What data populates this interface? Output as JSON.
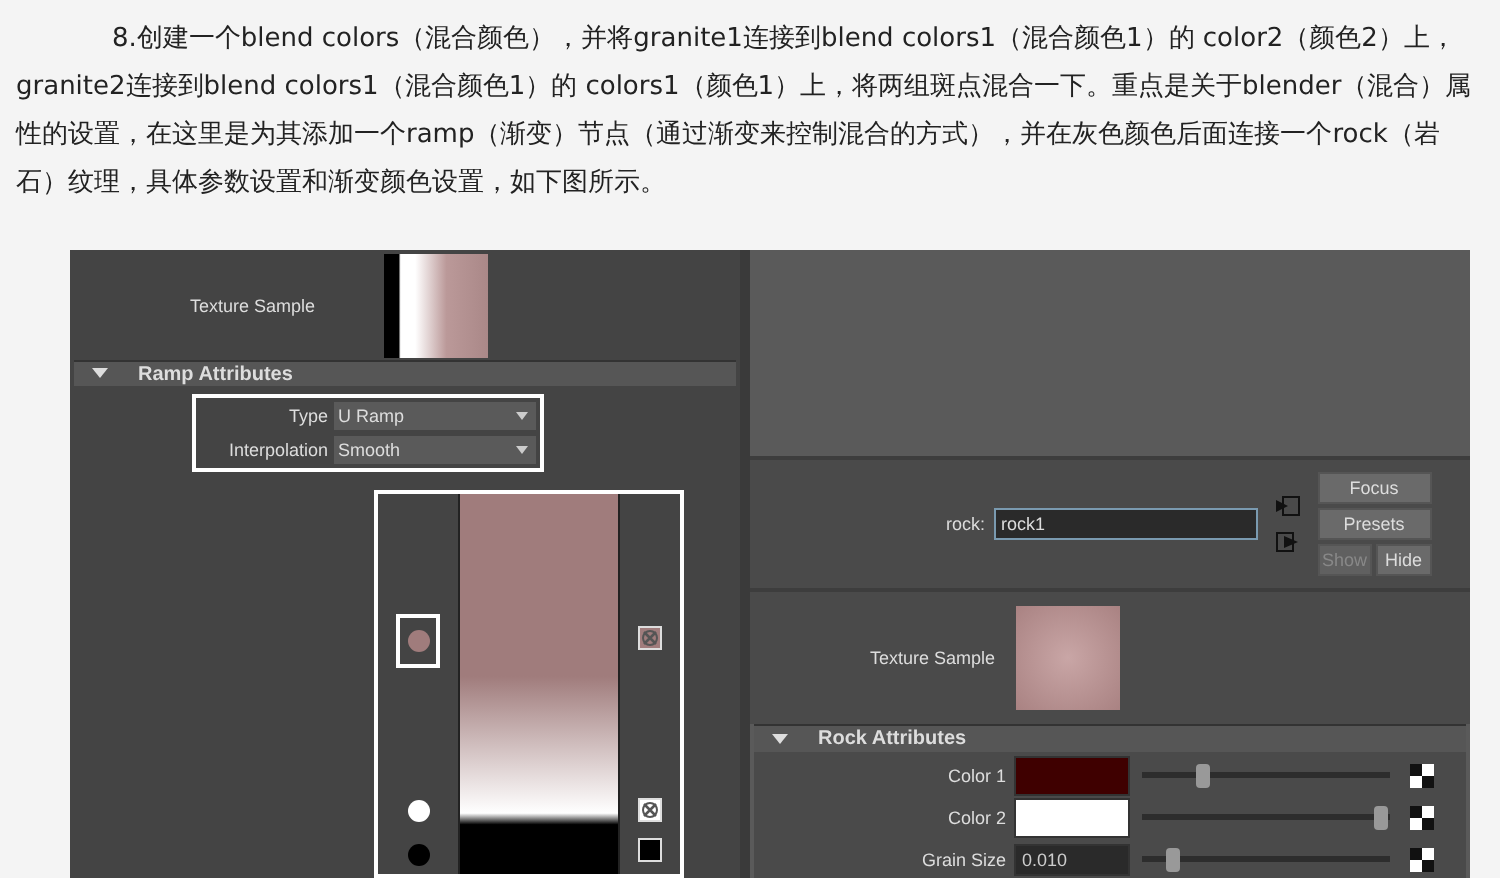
{
  "paragraph": "8.创建一个blend colors（混合颜色），并将granite1连接到blend colors1（混合颜色1）的 color2（颜色2）上，granite2连接到blend colors1（混合颜色1）的 colors1（颜色1）上，将两组斑点混合一下。重点是关于blender（混合）属性的设置，在这里是为其添加一个ramp（渐变）节点（通过渐变来控制混合的方式），并在灰色颜色后面连接一个rock（岩石）纹理，具体参数设置和渐变颜色设置，如下图所示。",
  "left_panel": {
    "texture_sample": {
      "label": "Texture Sample"
    },
    "section": {
      "title": "Ramp Attributes",
      "expanded": true
    },
    "fields": [
      {
        "label": "Type",
        "value": "U Ramp"
      },
      {
        "label": "Interpolation",
        "value": "Smooth"
      }
    ],
    "ramp_entries": [
      {
        "color": "#a07c7c",
        "selected": true,
        "delete_mark": true
      },
      {
        "color": "#ffffff",
        "selected": false,
        "delete_mark": true
      },
      {
        "color": "#000000",
        "selected": false,
        "delete_mark": false
      }
    ]
  },
  "right_panel": {
    "node": {
      "label": "rock:",
      "value": "rock1"
    },
    "buttons": [
      {
        "label": "Focus",
        "disabled": false
      },
      {
        "label": "Presets",
        "disabled": false
      },
      {
        "label": "Show",
        "disabled": true
      },
      {
        "label": "Hide",
        "disabled": false
      }
    ],
    "texture_sample": {
      "label": "Texture Sample"
    },
    "section": {
      "title": "Rock Attributes",
      "expanded": true
    },
    "attributes": [
      {
        "kind": "color",
        "label": "Color 1",
        "color": "#3f0000",
        "level": 0.24
      },
      {
        "kind": "color",
        "label": "Color 2",
        "color": "#ffffff",
        "level": 0.96
      },
      {
        "kind": "number",
        "label": "Grain Size",
        "value": "0.010",
        "level": 0.12
      }
    ]
  }
}
